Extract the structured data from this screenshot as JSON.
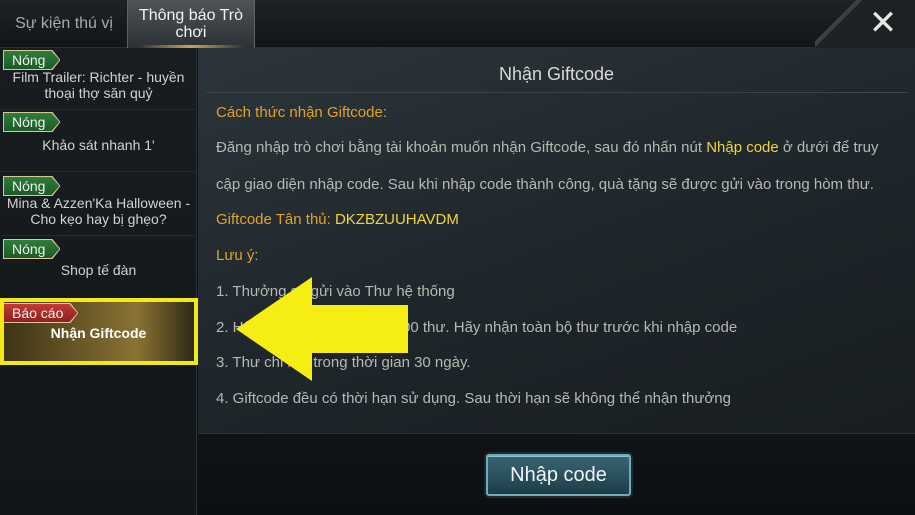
{
  "tabs": {
    "inactive": "Sự kiện thú vị",
    "active": "Thông báo Trò chơi"
  },
  "close_icon": "close-icon",
  "sidebar": {
    "items": [
      {
        "badge": "Nóng",
        "title": "Film Trailer: Richter - huyền thoại thợ săn quỷ"
      },
      {
        "badge": "Nóng",
        "title": "Khảo sát nhanh 1'"
      },
      {
        "badge": "Nóng",
        "title": "Mina & Azzen'Ka Halloween - Cho kẹo hay bị ghẹo?"
      },
      {
        "badge": "Nóng",
        "title": "Shop tế đàn"
      },
      {
        "badge": "Báo cáo",
        "title": "Nhận Giftcode"
      }
    ]
  },
  "main": {
    "title": "Nhận Giftcode",
    "how_heading": "Cách thức nhận Giftcode:",
    "para1_pre": "Đăng nhập trò chơi bằng tài khoản muốn nhận Giftcode, sau đó nhấn nút ",
    "para1_highlight": "Nhập code",
    "para1_post": " ở dưới để truy",
    "para2": "cập giao diện nhập code. Sau khi nhập code thành công, quà tặng sẽ được gửi vào trong hòm thư.",
    "giftcode_label": "Giftcode Tân thủ: ",
    "giftcode_value": "DKZBZUUHAVDM",
    "note_heading": "Lưu ý:",
    "notes": [
      "1. Thưởng sẽ gửi vào Thư hệ thống",
      "2. Hộp thư chỉ chứa tối đa 100 thư. Hãy nhận toàn bộ thư trước khi nhập code",
      "3. Thư chỉ lưu trong thời gian 30 ngày.",
      "4. Giftcode đều có thời hạn sử dụng. Sau thời hạn sẽ không thể nhận thưởng"
    ],
    "button_label": "Nhập code"
  },
  "colors": {
    "badge_hot": "#2f7e3a",
    "badge_report": "#c43a36",
    "heading_orange": "#e2a12c",
    "highlight_yellow": "#f2d43c",
    "annotation_yellow": "#f2ea16"
  }
}
